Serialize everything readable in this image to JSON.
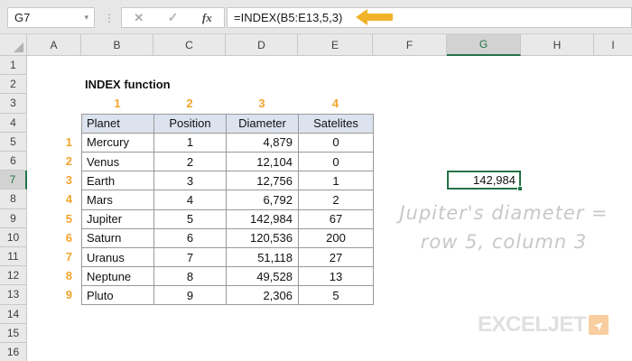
{
  "formula_bar": {
    "name_box_value": "G7",
    "formula": "=INDEX(B5:E13,5,3)",
    "icons": {
      "dropdown": "▾",
      "separator": "⋮",
      "cancel": "✕",
      "enter": "✓",
      "fx": "fx"
    }
  },
  "grid": {
    "columns": [
      "A",
      "B",
      "C",
      "D",
      "E",
      "F",
      "G",
      "H",
      "I"
    ],
    "rows": [
      "1",
      "2",
      "3",
      "4",
      "5",
      "6",
      "7",
      "8",
      "9",
      "10",
      "11",
      "12",
      "13",
      "14",
      "15",
      "16"
    ]
  },
  "selection": {
    "cell": "G7",
    "column": "G",
    "row": "7",
    "value": "142,984"
  },
  "sheet": {
    "title": "INDEX function",
    "column_indices": [
      "1",
      "2",
      "3",
      "4"
    ],
    "row_indices": [
      "1",
      "2",
      "3",
      "4",
      "5",
      "6",
      "7",
      "8",
      "9"
    ],
    "table": {
      "headers": [
        "Planet",
        "Position",
        "Diameter",
        "Satelites"
      ],
      "rows": [
        [
          "Mercury",
          "1",
          "4,879",
          "0"
        ],
        [
          "Venus",
          "2",
          "12,104",
          "0"
        ],
        [
          "Earth",
          "3",
          "12,756",
          "1"
        ],
        [
          "Mars",
          "4",
          "6,792",
          "2"
        ],
        [
          "Jupiter",
          "5",
          "142,984",
          "67"
        ],
        [
          "Saturn",
          "6",
          "120,536",
          "200"
        ],
        [
          "Uranus",
          "7",
          "51,118",
          "27"
        ],
        [
          "Neptune",
          "8",
          "49,528",
          "13"
        ],
        [
          "Pluto",
          "9",
          "2,306",
          "5"
        ]
      ]
    },
    "annotation": {
      "line1": "Jupiter's diameter =",
      "line2": "row 5, column 3"
    }
  },
  "logo": {
    "text": "EXCELJET",
    "arrow_icon": "➤"
  },
  "colors": {
    "accent_orange": "#F2A42C",
    "arrow_amber": "#F0B32A",
    "selection_green": "#217346",
    "header_fill": "#DCE3EF",
    "logo_gray": "#E0E0E0",
    "logo_arrow_bg": "#F8CEA0",
    "handwriting_gray": "#C8C8C8"
  }
}
